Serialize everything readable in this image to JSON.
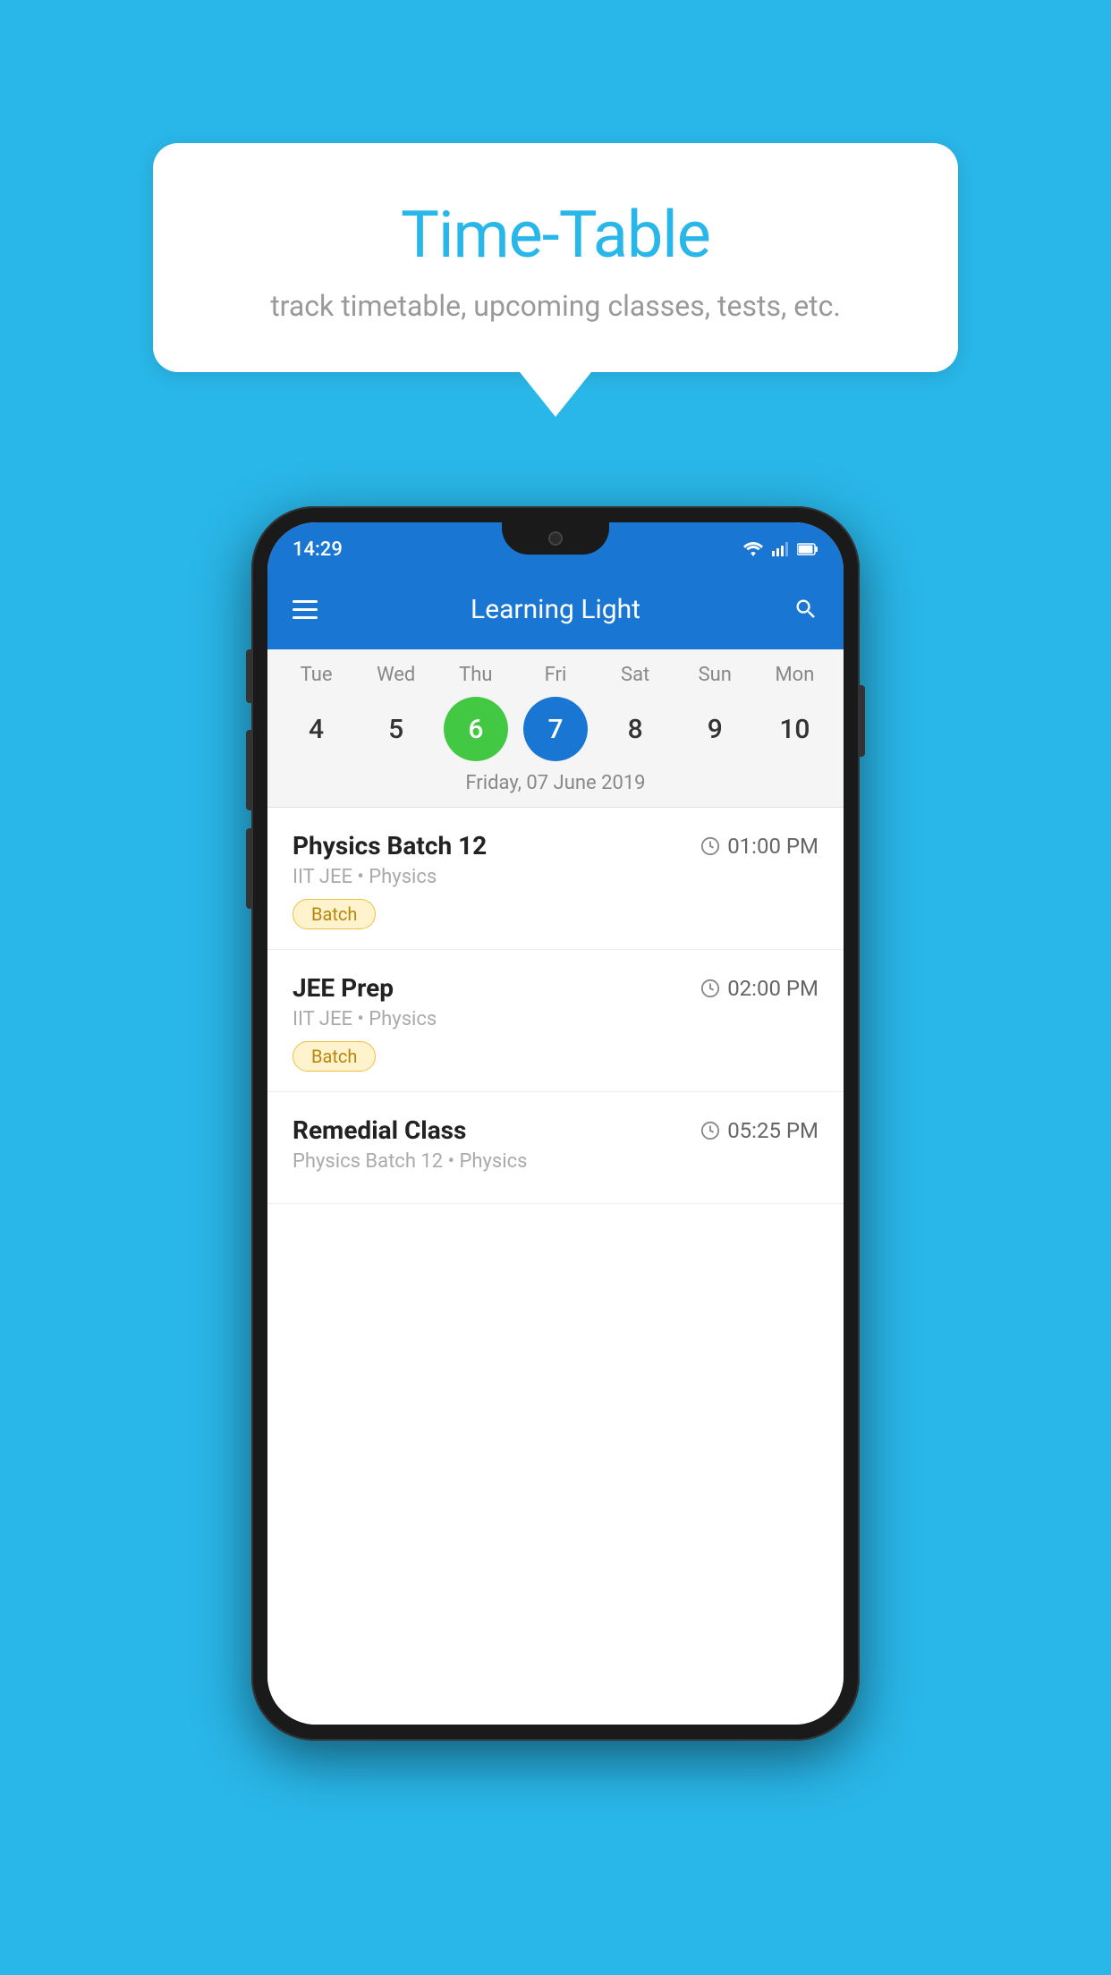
{
  "background_color": "#29B6E8",
  "speech_bubble": {
    "title": "Time-Table",
    "subtitle": "track timetable, upcoming classes, tests, etc."
  },
  "phone": {
    "status_bar": {
      "time": "14:29",
      "icons": [
        "wifi",
        "signal",
        "battery"
      ]
    },
    "app_bar": {
      "title": "Learning Light"
    },
    "calendar": {
      "day_headers": [
        "Tue",
        "Wed",
        "Thu",
        "Fri",
        "Sat",
        "Sun",
        "Mon"
      ],
      "days": [
        {
          "num": "4",
          "state": "normal"
        },
        {
          "num": "5",
          "state": "normal"
        },
        {
          "num": "6",
          "state": "today"
        },
        {
          "num": "7",
          "state": "selected"
        },
        {
          "num": "8",
          "state": "normal"
        },
        {
          "num": "9",
          "state": "normal"
        },
        {
          "num": "10",
          "state": "normal"
        }
      ],
      "selected_date_label": "Friday, 07 June 2019"
    },
    "schedule": {
      "items": [
        {
          "title": "Physics Batch 12",
          "time": "01:00 PM",
          "subtitle": "IIT JEE • Physics",
          "badge": "Batch"
        },
        {
          "title": "JEE Prep",
          "time": "02:00 PM",
          "subtitle": "IIT JEE • Physics",
          "badge": "Batch"
        },
        {
          "title": "Remedial Class",
          "time": "05:25 PM",
          "subtitle": "Physics Batch 12 • Physics",
          "badge": null
        }
      ]
    }
  }
}
